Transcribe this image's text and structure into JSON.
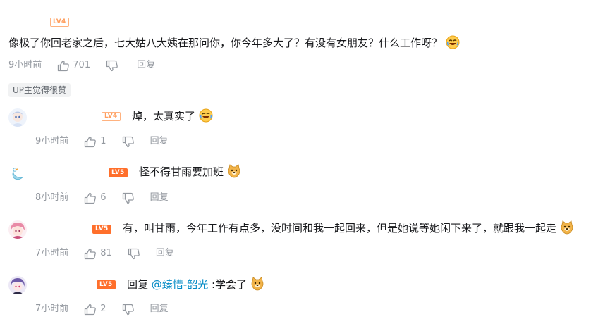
{
  "main_comment": {
    "level": "LV4",
    "text": "像极了你回老家之后，七大姑八大姨在那问你，你今年多大了？有没有女朋友？什么工作呀？",
    "time": "9小时前",
    "likes": "701",
    "reply_label": "回复",
    "up_badge": "UP主觉得很赞"
  },
  "replies": [
    {
      "level": "LV4",
      "text": "焯，太真实了",
      "time": "9小时前",
      "likes": "1",
      "reply_label": "回复"
    },
    {
      "level": "LV5",
      "text": "怪不得甘雨要加班",
      "time": "8小时前",
      "likes": "6",
      "reply_label": "回复"
    },
    {
      "level": "LV5",
      "text": "有，叫甘雨，今年工作有点多，没时间和我一起回来，但是她说等她闲下来了，就跟我一起走",
      "time": "7小时前",
      "likes": "81",
      "reply_label": "回复"
    },
    {
      "level": "LV5",
      "reply_prefix": "回复",
      "mention": "@臻惜-韶光",
      "text": ":学会了",
      "time": "7小时前",
      "likes": "2",
      "reply_label": "回复"
    }
  ],
  "icons": [
    "thumbs-up-icon",
    "thumbs-down-icon",
    "laughing-emoji",
    "doge-emoji"
  ],
  "colors": {
    "level4": "#ff9e5e",
    "level5": "#ff6f2b",
    "mention": "#008ac5",
    "meta": "#9499a0"
  }
}
